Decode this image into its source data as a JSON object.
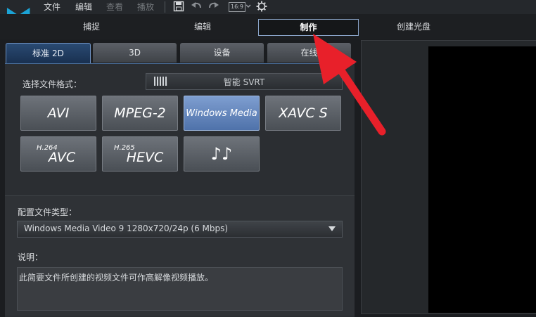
{
  "menu": {
    "file": "文件",
    "edit": "编辑",
    "view": "查看",
    "play": "播放",
    "aspect": "16:9"
  },
  "modes": {
    "capture": "捕捉",
    "edit": "编辑",
    "produce": "制作",
    "disc": "创建光盘"
  },
  "subtabs": {
    "standard2d": "标准 2D",
    "threed": "3D",
    "device": "设备",
    "online": "在线"
  },
  "format": {
    "label": "选择文件格式：",
    "svrt": "智能 SVRT",
    "buttons": {
      "avi": "AVI",
      "mpeg2": "MPEG-2",
      "wmv": "Windows Media",
      "xavcs": "XAVC S",
      "avc_sup": "H.264",
      "avc": "AVC",
      "hevc_sup": "H.265",
      "hevc": "HEVC",
      "audio": "♪♪"
    }
  },
  "profile": {
    "label": "配置文件类型：",
    "value": "Windows Media Video 9 1280x720/24p (6 Mbps)"
  },
  "description": {
    "label": "说明：",
    "text": "此简要文件所创建的视频文件可作高解像视频播放。"
  },
  "colors": {
    "accent": "#6f93c4",
    "selected_format": "#5d80b8",
    "annotation_arrow": "#e8202a"
  }
}
